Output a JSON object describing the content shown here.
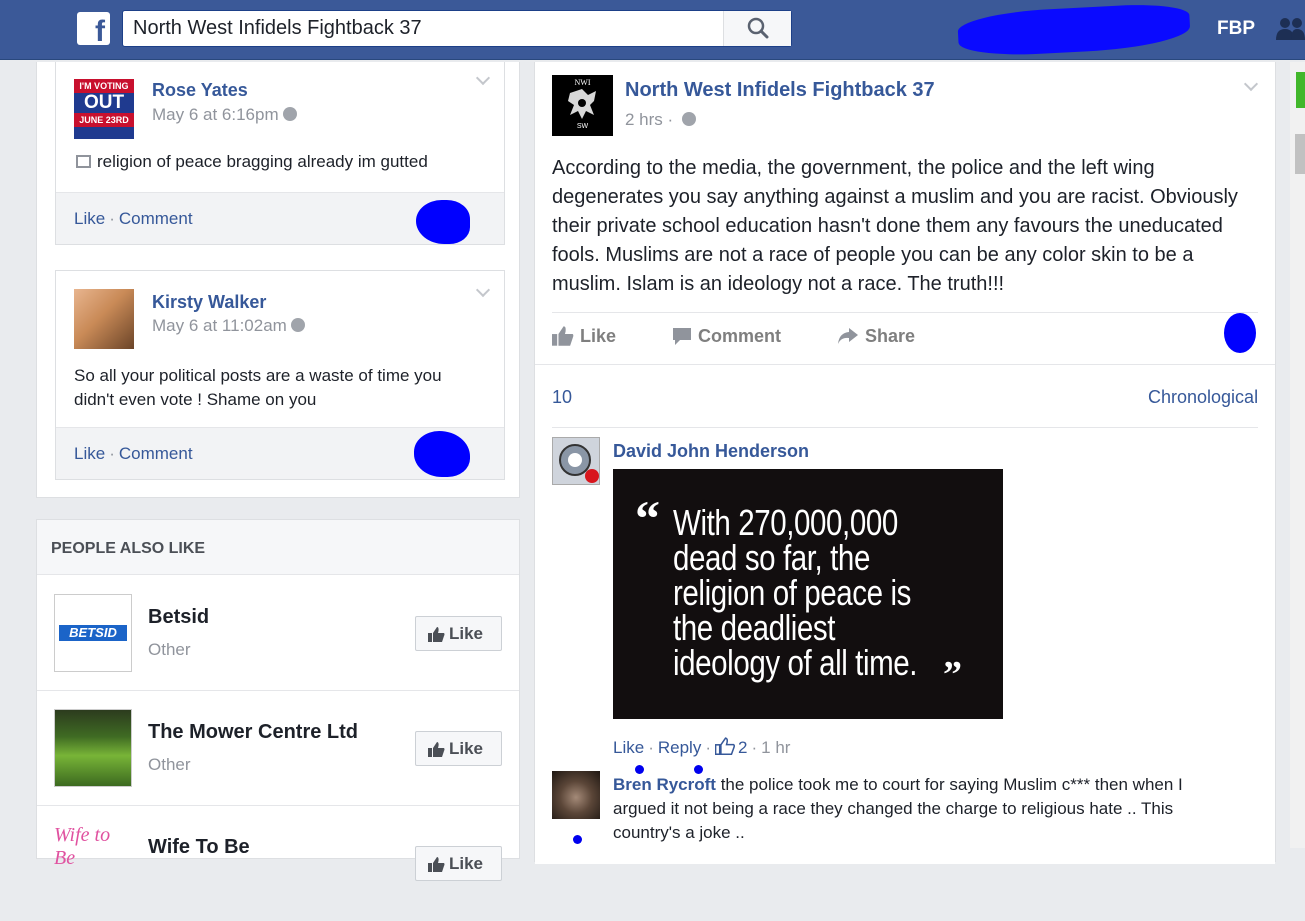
{
  "header": {
    "search_value": "North West Infidels Fightback 37",
    "user_label": "FBP",
    "icons": [
      "facebook-logo-icon",
      "search-icon",
      "friends-icon"
    ]
  },
  "left_comments": [
    {
      "name": "Rose Yates",
      "avatar_text": [
        "I'M VOTING",
        "OUT",
        "JUNE 23RD"
      ],
      "time": "May 6 at 6:16pm",
      "text": "religion of peace bragging already im gutted",
      "like": "Like",
      "comment": "Comment"
    },
    {
      "name": "Kirsty Walker",
      "time": "May 6 at 11:02am",
      "text": "So all your political posts are a waste of time you didn't even vote ! Shame on you",
      "like": "Like",
      "comment": "Comment"
    }
  ],
  "people_also_like": {
    "heading": "PEOPLE ALSO LIKE",
    "items": [
      {
        "name": "Betsid",
        "category": "Other",
        "button": "Like",
        "logo_text": "BETSID"
      },
      {
        "name": "The Mower Centre Ltd",
        "category": "Other",
        "button": "Like"
      },
      {
        "name": "Wife To Be",
        "category": "",
        "button": "Like",
        "logo_text": "Wife to Be"
      }
    ]
  },
  "post": {
    "page_name": "North West Infidels Fightback 37",
    "avatar_text": "NWI",
    "avatar_subtext": "SW",
    "time": "2 hrs",
    "text": "According to the media, the government, the police and the left wing degenerates you say anything against a muslim and you are racist. Obviously their private school education hasn't done them any favours the uneducated fools. Muslims are not a race of people you can be any color skin to be a muslim. Islam is an ideology not a race. The truth!!!",
    "actions": {
      "like": "Like",
      "comment": "Comment",
      "share": "Share"
    },
    "comment_count": "10",
    "sort_label": "Chronological"
  },
  "comments": [
    {
      "name": "David John Henderson",
      "image_quote": "With 270,000,000 dead so far, the religion of peace is the deadliest ideology of all time.",
      "like": "Like",
      "reply": "Reply",
      "reactions": "2",
      "time": "1 hr"
    },
    {
      "name": "Bren Rycroft",
      "text": "the police took me to court for saying Muslim c*** then when I argued it not being a race they changed the charge to religious hate .. This country's a joke .."
    }
  ],
  "colors": {
    "topbar": "#3b5998",
    "link": "#365899",
    "redaction": "#0000ff"
  }
}
